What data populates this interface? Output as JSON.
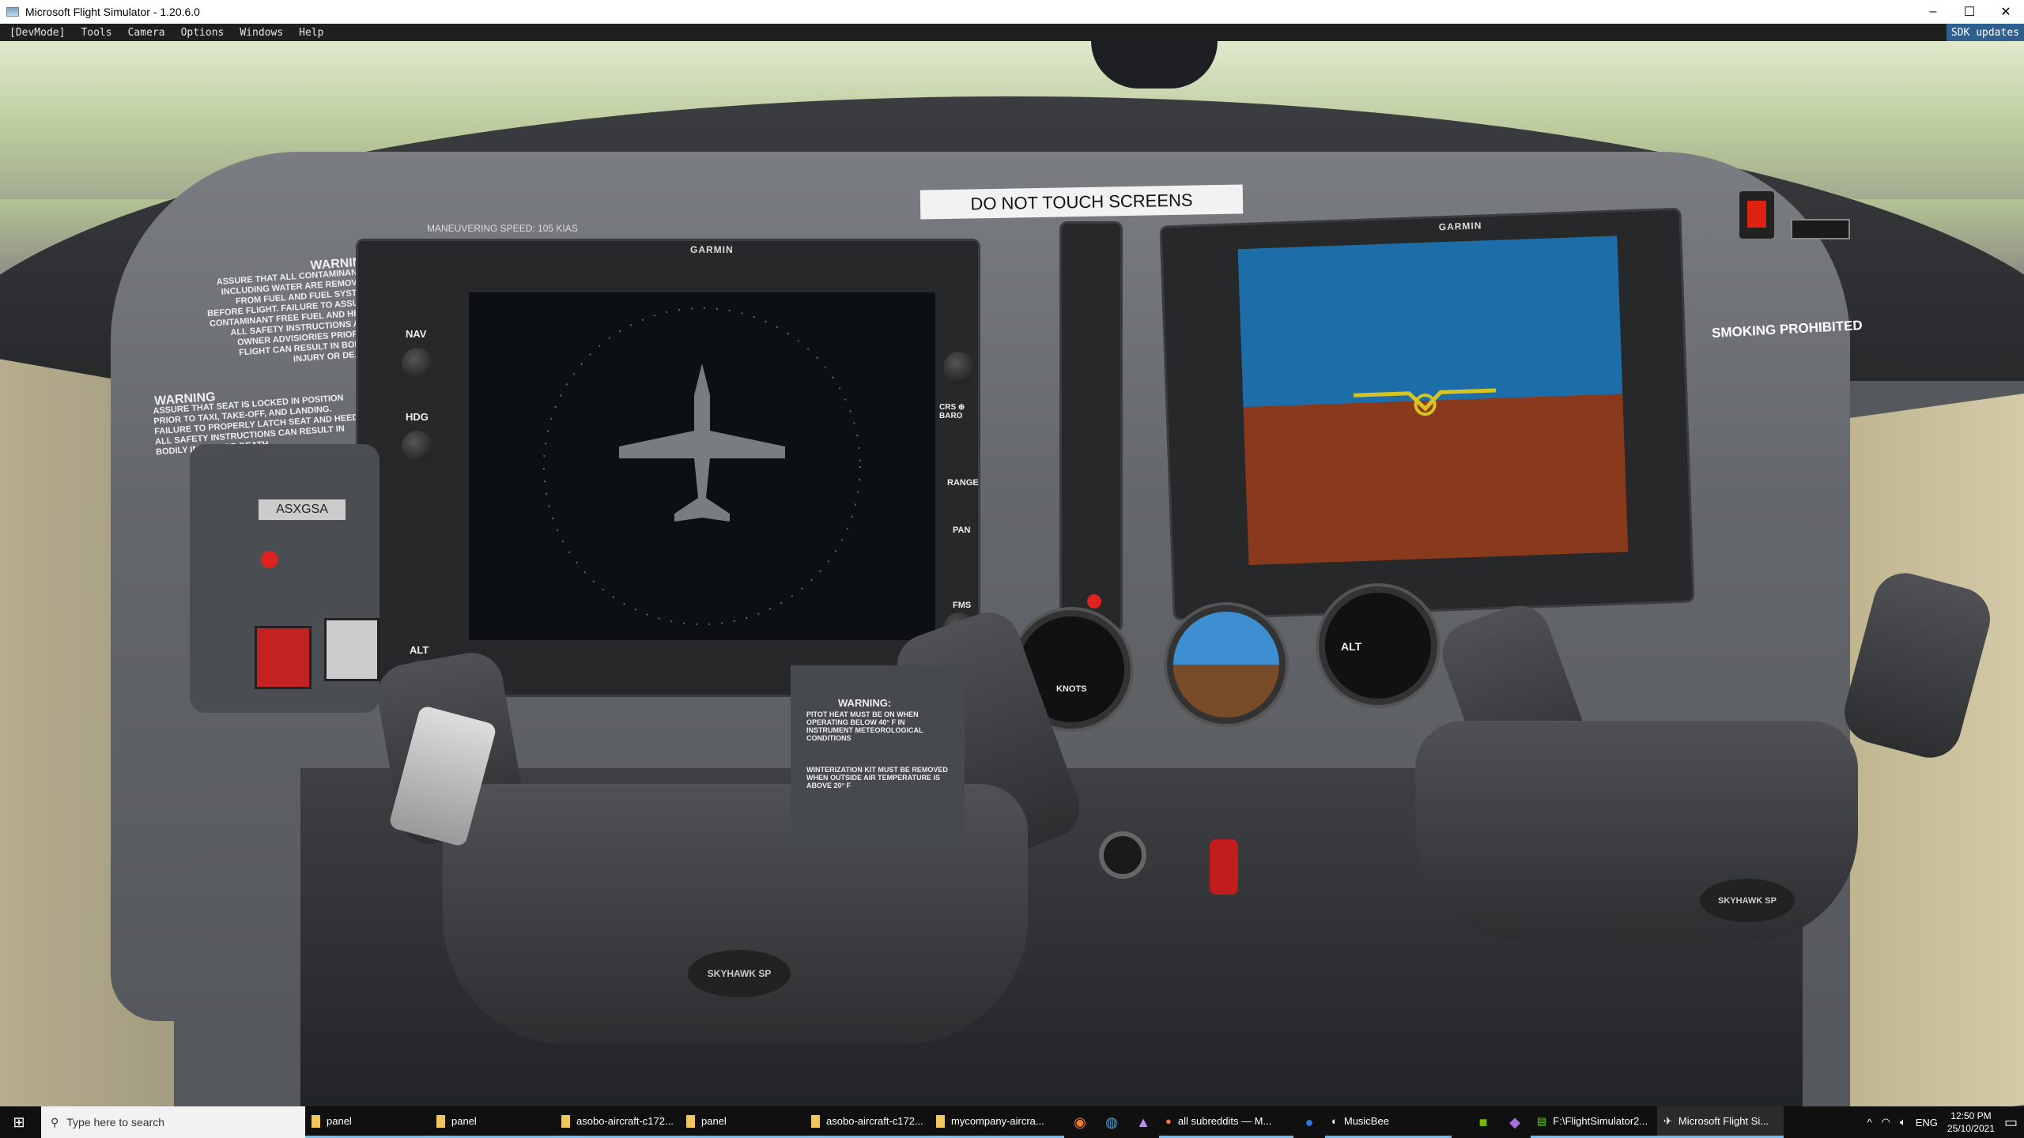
{
  "window": {
    "title": "Microsoft Flight Simulator - 1.20.6.0",
    "controls": [
      "minimize",
      "maximize",
      "close"
    ]
  },
  "menu": {
    "items": [
      "[DevMode]",
      "Tools",
      "Camera",
      "Options",
      "Windows",
      "Help"
    ],
    "sdk_updates": "SDK updates"
  },
  "cockpit": {
    "placard_top": "DO NOT TOUCH SCREENS",
    "maneuvering_speed": "MANEUVERING SPEED:  105 KIAS",
    "warning1_title": "WARNING",
    "warning1_text": "ASSURE THAT ALL CONTAMINANTS INCLUDING WATER ARE REMOVED FROM FUEL AND FUEL SYSTEM BEFORE FLIGHT. FAILURE TO ASSURE CONTAMINANT FREE FUEL AND HEED ALL SAFETY INSTRUCTIONS AND OWNER ADVISIORIES PRIOR TO FLIGHT CAN RESULT IN BODILY INJURY OR DEATH.",
    "warning2_title": "WARNING",
    "warning2_text": "ASSURE THAT SEAT IS LOCKED IN POSITION PRIOR TO TAXI, TAKE-OFF, AND LANDING. FAILURE TO PROPERLY LATCH SEAT AND HEED ALL SAFETY INSTRUCTIONS CAN RESULT IN BODILY INJURY OR DEATH.",
    "warning3_title": "WARNING:",
    "warning3_text": "PITOT HEAT MUST BE ON WHEN OPERATING BELOW 40° F IN INSTRUMENT METEOROLOGICAL CONDITIONS",
    "winterization": "WINTERIZATION KIT MUST BE REMOVED WHEN OUTSIDE AIR TEMPERATURE IS ABOVE 20° F",
    "smoking": "SMOKING PROHIBITED",
    "tail_number": "ASXGSA",
    "brand": "GARMIN",
    "knob_labels": {
      "nav": "NAV",
      "hdg": "HDG",
      "alt": "ALT",
      "range": "RANGE",
      "pan": "PAN",
      "fms": "FMS",
      "baro": "CRS ⊕ BARO"
    },
    "yoke_label": "SKYHAWK SP",
    "gauges": {
      "airspeed": "KNOTS",
      "altimeter": "ALT"
    }
  },
  "taskbar": {
    "search_placeholder": "Type here to search",
    "items": [
      {
        "label": "panel",
        "icon": "folder-icon"
      },
      {
        "label": "panel",
        "icon": "folder-icon"
      },
      {
        "label": "asobo-aircraft-c172...",
        "icon": "folder-icon"
      },
      {
        "label": "panel",
        "icon": "folder-icon"
      },
      {
        "label": "asobo-aircraft-c172...",
        "icon": "folder-icon"
      },
      {
        "label": "mycompany-aircra...",
        "icon": "folder-icon"
      }
    ],
    "firefox": "all subreddits — M...",
    "musicbee": "MusicBee",
    "notepad": "F:\\FlightSimulator2...",
    "msfs": "Microsoft Flight Si...",
    "lang": "ENG",
    "time": "12:50 PM",
    "date": "25/10/2021"
  },
  "colors": {
    "mfd_sky": "#1d6ea8",
    "mfd_ground": "#8a3a1c",
    "accent": "#76b9ed",
    "sdk": "#2f5f8f"
  }
}
